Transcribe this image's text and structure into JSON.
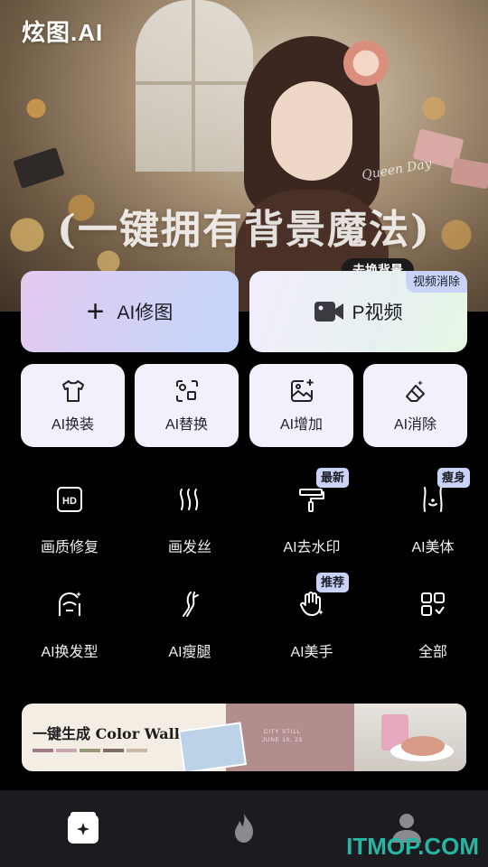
{
  "app": {
    "logo": "炫图.AI"
  },
  "hero": {
    "title": "(一键拥有背景魔法)",
    "signature": "Queen Day",
    "tag": "去换背景"
  },
  "big_buttons": {
    "ai_retouch": "AI修图",
    "p_video": "P视频",
    "p_video_badge": "视频消除"
  },
  "small_buttons": [
    {
      "label": "AI换装",
      "icon": "shirt-icon"
    },
    {
      "label": "AI替换",
      "icon": "replace-icon"
    },
    {
      "label": "AI增加",
      "icon": "image-add-icon"
    },
    {
      "label": "AI消除",
      "icon": "eraser-icon"
    }
  ],
  "tools": [
    {
      "label": "画质修复",
      "icon": "hd-icon",
      "badge": ""
    },
    {
      "label": "画发丝",
      "icon": "hair-strands-icon",
      "badge": ""
    },
    {
      "label": "AI去水印",
      "icon": "roller-icon",
      "badge": "最新"
    },
    {
      "label": "AI美体",
      "icon": "body-shape-icon",
      "badge": "瘦身"
    },
    {
      "label": "AI换发型",
      "icon": "hairstyle-icon",
      "badge": ""
    },
    {
      "label": "AI瘦腿",
      "icon": "leg-icon",
      "badge": ""
    },
    {
      "label": "AI美手",
      "icon": "hand-icon",
      "badge": "推荐"
    },
    {
      "label": "全部",
      "icon": "all-apps-icon",
      "badge": ""
    }
  ],
  "promo": {
    "title": "一键生成 Color Walk",
    "mid_text": "CITY STILL\nJUNE 10, 23",
    "swatch_colors": [
      "#9e7b86",
      "#c8a8b2",
      "#9a9a7a",
      "#7f6e66",
      "#c9b9a4"
    ]
  },
  "nav": {
    "items": [
      "create-icon",
      "flame-icon",
      "profile-icon"
    ]
  },
  "watermark": "ITMOP.COM",
  "colors": {
    "accent_badge": "#c9d3f8",
    "watermark": "#27b6a3",
    "nav_bg": "#1c1c20"
  }
}
